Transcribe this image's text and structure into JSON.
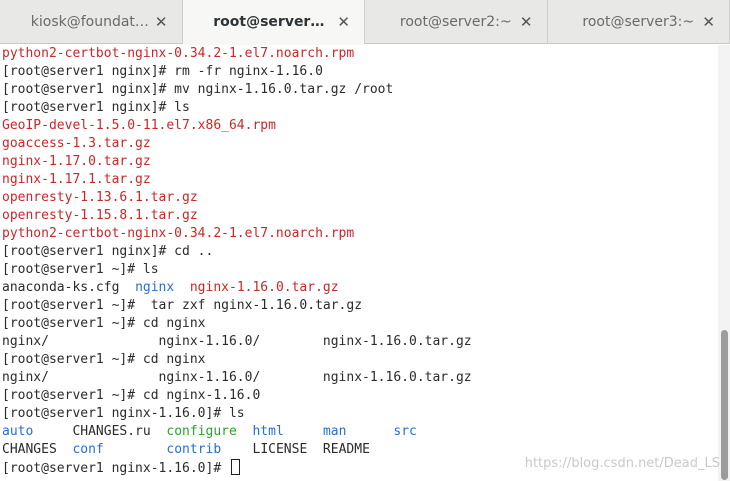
{
  "tabs": [
    {
      "label": "kiosk@foundati...",
      "close": "✕"
    },
    {
      "label": "root@server1:...",
      "close": "✕"
    },
    {
      "label": "root@server2:~",
      "close": "✕"
    },
    {
      "label": "root@server3:~",
      "close": "✕"
    }
  ],
  "terminal": {
    "lines": [
      [
        {
          "t": "python2-certbot-nginx-0.34.2-1.el7.noarch.rpm",
          "c": "red"
        }
      ],
      [
        {
          "t": "[root@server1 nginx]# rm -fr nginx-1.16.0",
          "c": "plain"
        }
      ],
      [
        {
          "t": "[root@server1 nginx]# mv nginx-1.16.0.tar.gz /root",
          "c": "plain"
        }
      ],
      [
        {
          "t": "[root@server1 nginx]# ls",
          "c": "plain"
        }
      ],
      [
        {
          "t": "GeoIP-devel-1.5.0-11.el7.x86_64.rpm",
          "c": "red"
        }
      ],
      [
        {
          "t": "goaccess-1.3.tar.gz",
          "c": "red"
        }
      ],
      [
        {
          "t": "nginx-1.17.0.tar.gz",
          "c": "red"
        }
      ],
      [
        {
          "t": "nginx-1.17.1.tar.gz",
          "c": "red"
        }
      ],
      [
        {
          "t": "openresty-1.13.6.1.tar.gz",
          "c": "red"
        }
      ],
      [
        {
          "t": "openresty-1.15.8.1.tar.gz",
          "c": "red"
        }
      ],
      [
        {
          "t": "python2-certbot-nginx-0.34.2-1.el7.noarch.rpm",
          "c": "red"
        }
      ],
      [
        {
          "t": "[root@server1 nginx]# cd ..",
          "c": "plain"
        }
      ],
      [
        {
          "t": "[root@server1 ~]# ls",
          "c": "plain"
        }
      ],
      [
        {
          "t": "anaconda-ks.cfg  ",
          "c": "plain"
        },
        {
          "t": "nginx",
          "c": "blue"
        },
        {
          "t": "  ",
          "c": "plain"
        },
        {
          "t": "nginx-1.16.0.tar.gz",
          "c": "red"
        }
      ],
      [
        {
          "t": "[root@server1 ~]#  tar zxf nginx-1.16.0.tar.gz",
          "c": "plain"
        }
      ],
      [
        {
          "t": "[root@server1 ~]# cd nginx",
          "c": "plain"
        }
      ],
      [
        {
          "t": "nginx/              nginx-1.16.0/        nginx-1.16.0.tar.gz",
          "c": "plain"
        }
      ],
      [
        {
          "t": "[root@server1 ~]# cd nginx",
          "c": "plain"
        }
      ],
      [
        {
          "t": "nginx/              nginx-1.16.0/        nginx-1.16.0.tar.gz",
          "c": "plain"
        }
      ],
      [
        {
          "t": "[root@server1 ~]# cd nginx-1.16.0",
          "c": "plain"
        }
      ],
      [
        {
          "t": "[root@server1 nginx-1.16.0]# ls",
          "c": "plain"
        }
      ],
      [
        {
          "t": "auto",
          "c": "blue"
        },
        {
          "t": "     CHANGES.ru  ",
          "c": "plain"
        },
        {
          "t": "configure",
          "c": "green"
        },
        {
          "t": "  ",
          "c": "plain"
        },
        {
          "t": "html",
          "c": "blue"
        },
        {
          "t": "     ",
          "c": "plain"
        },
        {
          "t": "man",
          "c": "blue"
        },
        {
          "t": "      ",
          "c": "plain"
        },
        {
          "t": "src",
          "c": "blue"
        }
      ],
      [
        {
          "t": "CHANGES  ",
          "c": "plain"
        },
        {
          "t": "conf",
          "c": "blue"
        },
        {
          "t": "        ",
          "c": "plain"
        },
        {
          "t": "contrib",
          "c": "blue"
        },
        {
          "t": "    LICENSE  README",
          "c": "plain"
        }
      ],
      [
        {
          "t": "[root@server1 nginx-1.16.0]# ",
          "c": "plain"
        }
      ]
    ]
  },
  "watermark": "https://blog.csdn.net/Dead_LS"
}
